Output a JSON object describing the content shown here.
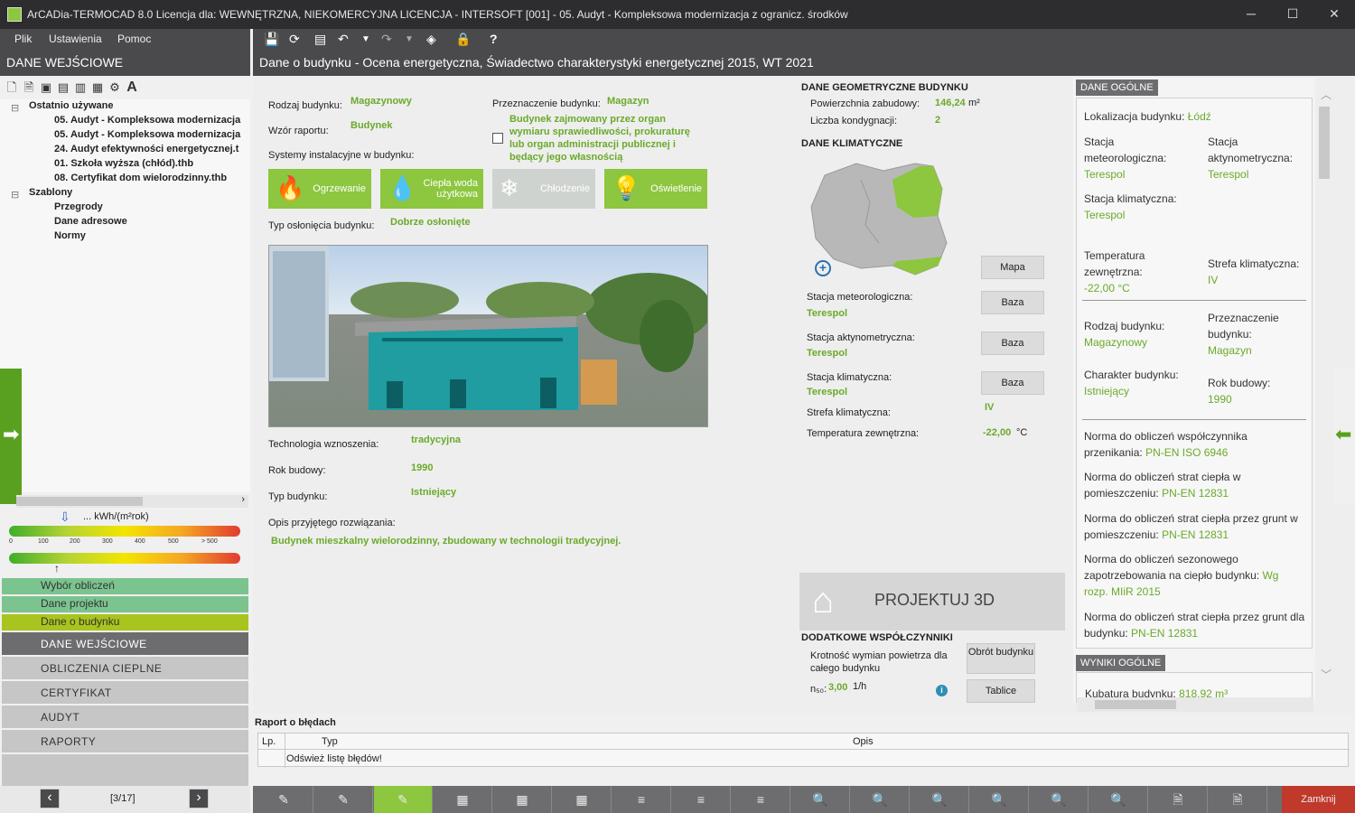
{
  "window": {
    "title": "ArCADia-TERMOCAD 8.0 Licencja dla: WEWNĘTRZNA, NIEKOMERCYJNA LICENCJA - INTERSOFT [001] - 05. Audyt - Kompleksowa modernizacja z ogranicz. środków",
    "minimize": "─",
    "maximize": "☐",
    "close": "✕"
  },
  "menu": {
    "file": "Plik",
    "settings": "Ustawienia",
    "help": "Pomoc"
  },
  "sidebar": {
    "header": "DANE WEJŚCIOWE",
    "tree": {
      "recent": "Ostatnio używane",
      "recent_items": [
        "05. Audyt - Kompleksowa modernizacja",
        "05. Audyt - Kompleksowa modernizacja",
        "24. Audyt efektywności energetycznej.t",
        "01. Szkoła wyższa (chłód).thb",
        "08. Certyfikat dom wielorodzinny.thb"
      ],
      "templates": "Szablony",
      "template_items": [
        "Przegrody",
        "Dane adresowe",
        "Normy"
      ]
    },
    "scale": {
      "unit": "... kWh/(m²rok)",
      "ticks": [
        "0",
        "100",
        "200",
        "300",
        "400",
        "500",
        "> 500"
      ]
    },
    "steps": [
      "Wybór obliczeń",
      "Dane projektu",
      "Dane o budynku"
    ],
    "stages": [
      "DANE WEJŚCIOWE",
      "OBLICZENIA CIEPLNE",
      "CERTYFIKAT",
      "AUDYT",
      "RAPORTY"
    ],
    "pager": "[3/17]",
    "prev": "‹",
    "next": "›"
  },
  "content": {
    "header": "Dane o budynku - Ocena energetyczna, Świadectwo charakterystyki energetycznej 2015, WT 2021",
    "building_type_label": "Rodzaj budynku:",
    "building_type": "Magazynowy",
    "report_template_label": "Wzór raportu:",
    "report_template": "Budynek",
    "purpose_label": "Przeznaczenie budynku:",
    "purpose": "Magazyn",
    "public_checkbox": "Budynek zajmowany przez organ wymiaru sprawiedliwości, prokuraturę lub organ administracji publicznej i będący jego własnością",
    "systems_label": "Systemy instalacyjne w budynku:",
    "systems": [
      {
        "label": "Ogrzewanie",
        "icon": "flame-icon",
        "enabled": true
      },
      {
        "label": "Ciepła woda użytkowa",
        "icon": "water-drop-icon",
        "enabled": true
      },
      {
        "label": "Chłodzenie",
        "icon": "snowflake-icon",
        "enabled": false
      },
      {
        "label": "Oświetlenie",
        "icon": "bulb-icon",
        "enabled": true
      }
    ],
    "shelter_label": "Typ osłonięcia budynku:",
    "shelter": "Dobrze osłonięte",
    "technology_label": "Technologia wznoszenia:",
    "technology": "tradycyjna",
    "year_label": "Rok budowy:",
    "year": "1990",
    "kind_label": "Typ budynku:",
    "kind": "Istniejący",
    "desc_label": "Opis przyjętego rozwiązania:",
    "desc": "Budynek mieszkalny wielorodzinny, zbudowany w technologii tradycyjnej.",
    "geo_header": "DANE GEOMETRYCZNE BUDYNKU",
    "area_label": "Powierzchnia zabudowy:",
    "area": "146,24",
    "area_unit": "m²",
    "floors_label": "Liczba kondygnacji:",
    "floors": "2",
    "climate_header": "DANE KLIMATYCZNE",
    "map_button": "Mapa",
    "met_label": "Stacja meteorologiczna:",
    "met": "Terespol",
    "met_button": "Baza",
    "act_label": "Stacja aktynometryczna:",
    "act": "Terespol",
    "act_button": "Baza",
    "clim_label": "Stacja klimatyczna:",
    "clim": "Terespol",
    "clim_button": "Baza",
    "zone_label": "Strefa klimatyczna:",
    "zone": "IV",
    "temp_label": "Temperatura zewnętrzna:",
    "temp": "-22,00",
    "temp_unit": "°C",
    "project3d": "PROJEKTUJ 3D",
    "extra_header": "DODATKOWE WSPÓŁCZYNNIKI",
    "air_label": "Krotność wymian powietrza dla całego budynku",
    "n50_label": "n₅₀:",
    "n50": "3,00",
    "n50_unit": "1/h",
    "rotation_button": "Obrót budynku",
    "tables_button": "Tablice"
  },
  "general": {
    "tag": "DANE OGÓLNE",
    "location_label": "Lokalizacja budynku:",
    "location": "Łódź",
    "met_label": "Stacja meteorologiczna:",
    "met": "Terespol",
    "act_label": "Stacja aktynometryczna:",
    "act": "Terespol",
    "clim_label": "Stacja klimatyczna:",
    "clim": "Terespol",
    "temp_label": "Temperatura zewnętrzna:",
    "temp": "-22,00 °C",
    "zone_label": "Strefa klimatyczna:",
    "zone": "IV",
    "type_label": "Rodzaj budynku:",
    "type": "Magazynowy",
    "purpose_label": "Przeznaczenie budynku:",
    "purpose": "Magazyn",
    "char_label": "Charakter budynku:",
    "char": "Istniejący",
    "year_label": "Rok budowy:",
    "year": "1990",
    "norm1_label": "Norma do obliczeń współczynnika przenikania:",
    "norm1": "PN-EN ISO 6946",
    "norm2_label": "Norma do obliczeń strat ciepła w pomieszczeniu:",
    "norm2": "PN-EN 12831",
    "norm3_label": "Norma do obliczeń strat ciepła przez grunt w pomieszczeniu:",
    "norm3": "PN-EN 12831",
    "norm4_label": "Norma do obliczeń sezonowego zapotrzebowania na ciepło budynku:",
    "norm4": "Wg rozp. MIiR 2015",
    "norm5_label": "Norma do obliczeń strat ciepła przez grunt dla budynku:",
    "norm5": "PN-EN 12831",
    "results_tag": "WYNIKI OGÓLNE",
    "volume_label": "Kubatura budynku:",
    "volume": "818.92 m³"
  },
  "report": {
    "title": "Raport o błędach",
    "col_no": "Lp.",
    "col_type": "Typ",
    "col_desc": "Opis",
    "refresh": "Odśwież listę błędów!"
  },
  "bottom": {
    "close": "Zamknij"
  },
  "colors": {
    "accent": "#8dc63f",
    "dark": "#4a4a4c",
    "value_green": "#6aaa2a",
    "close_red": "#c0392b"
  }
}
